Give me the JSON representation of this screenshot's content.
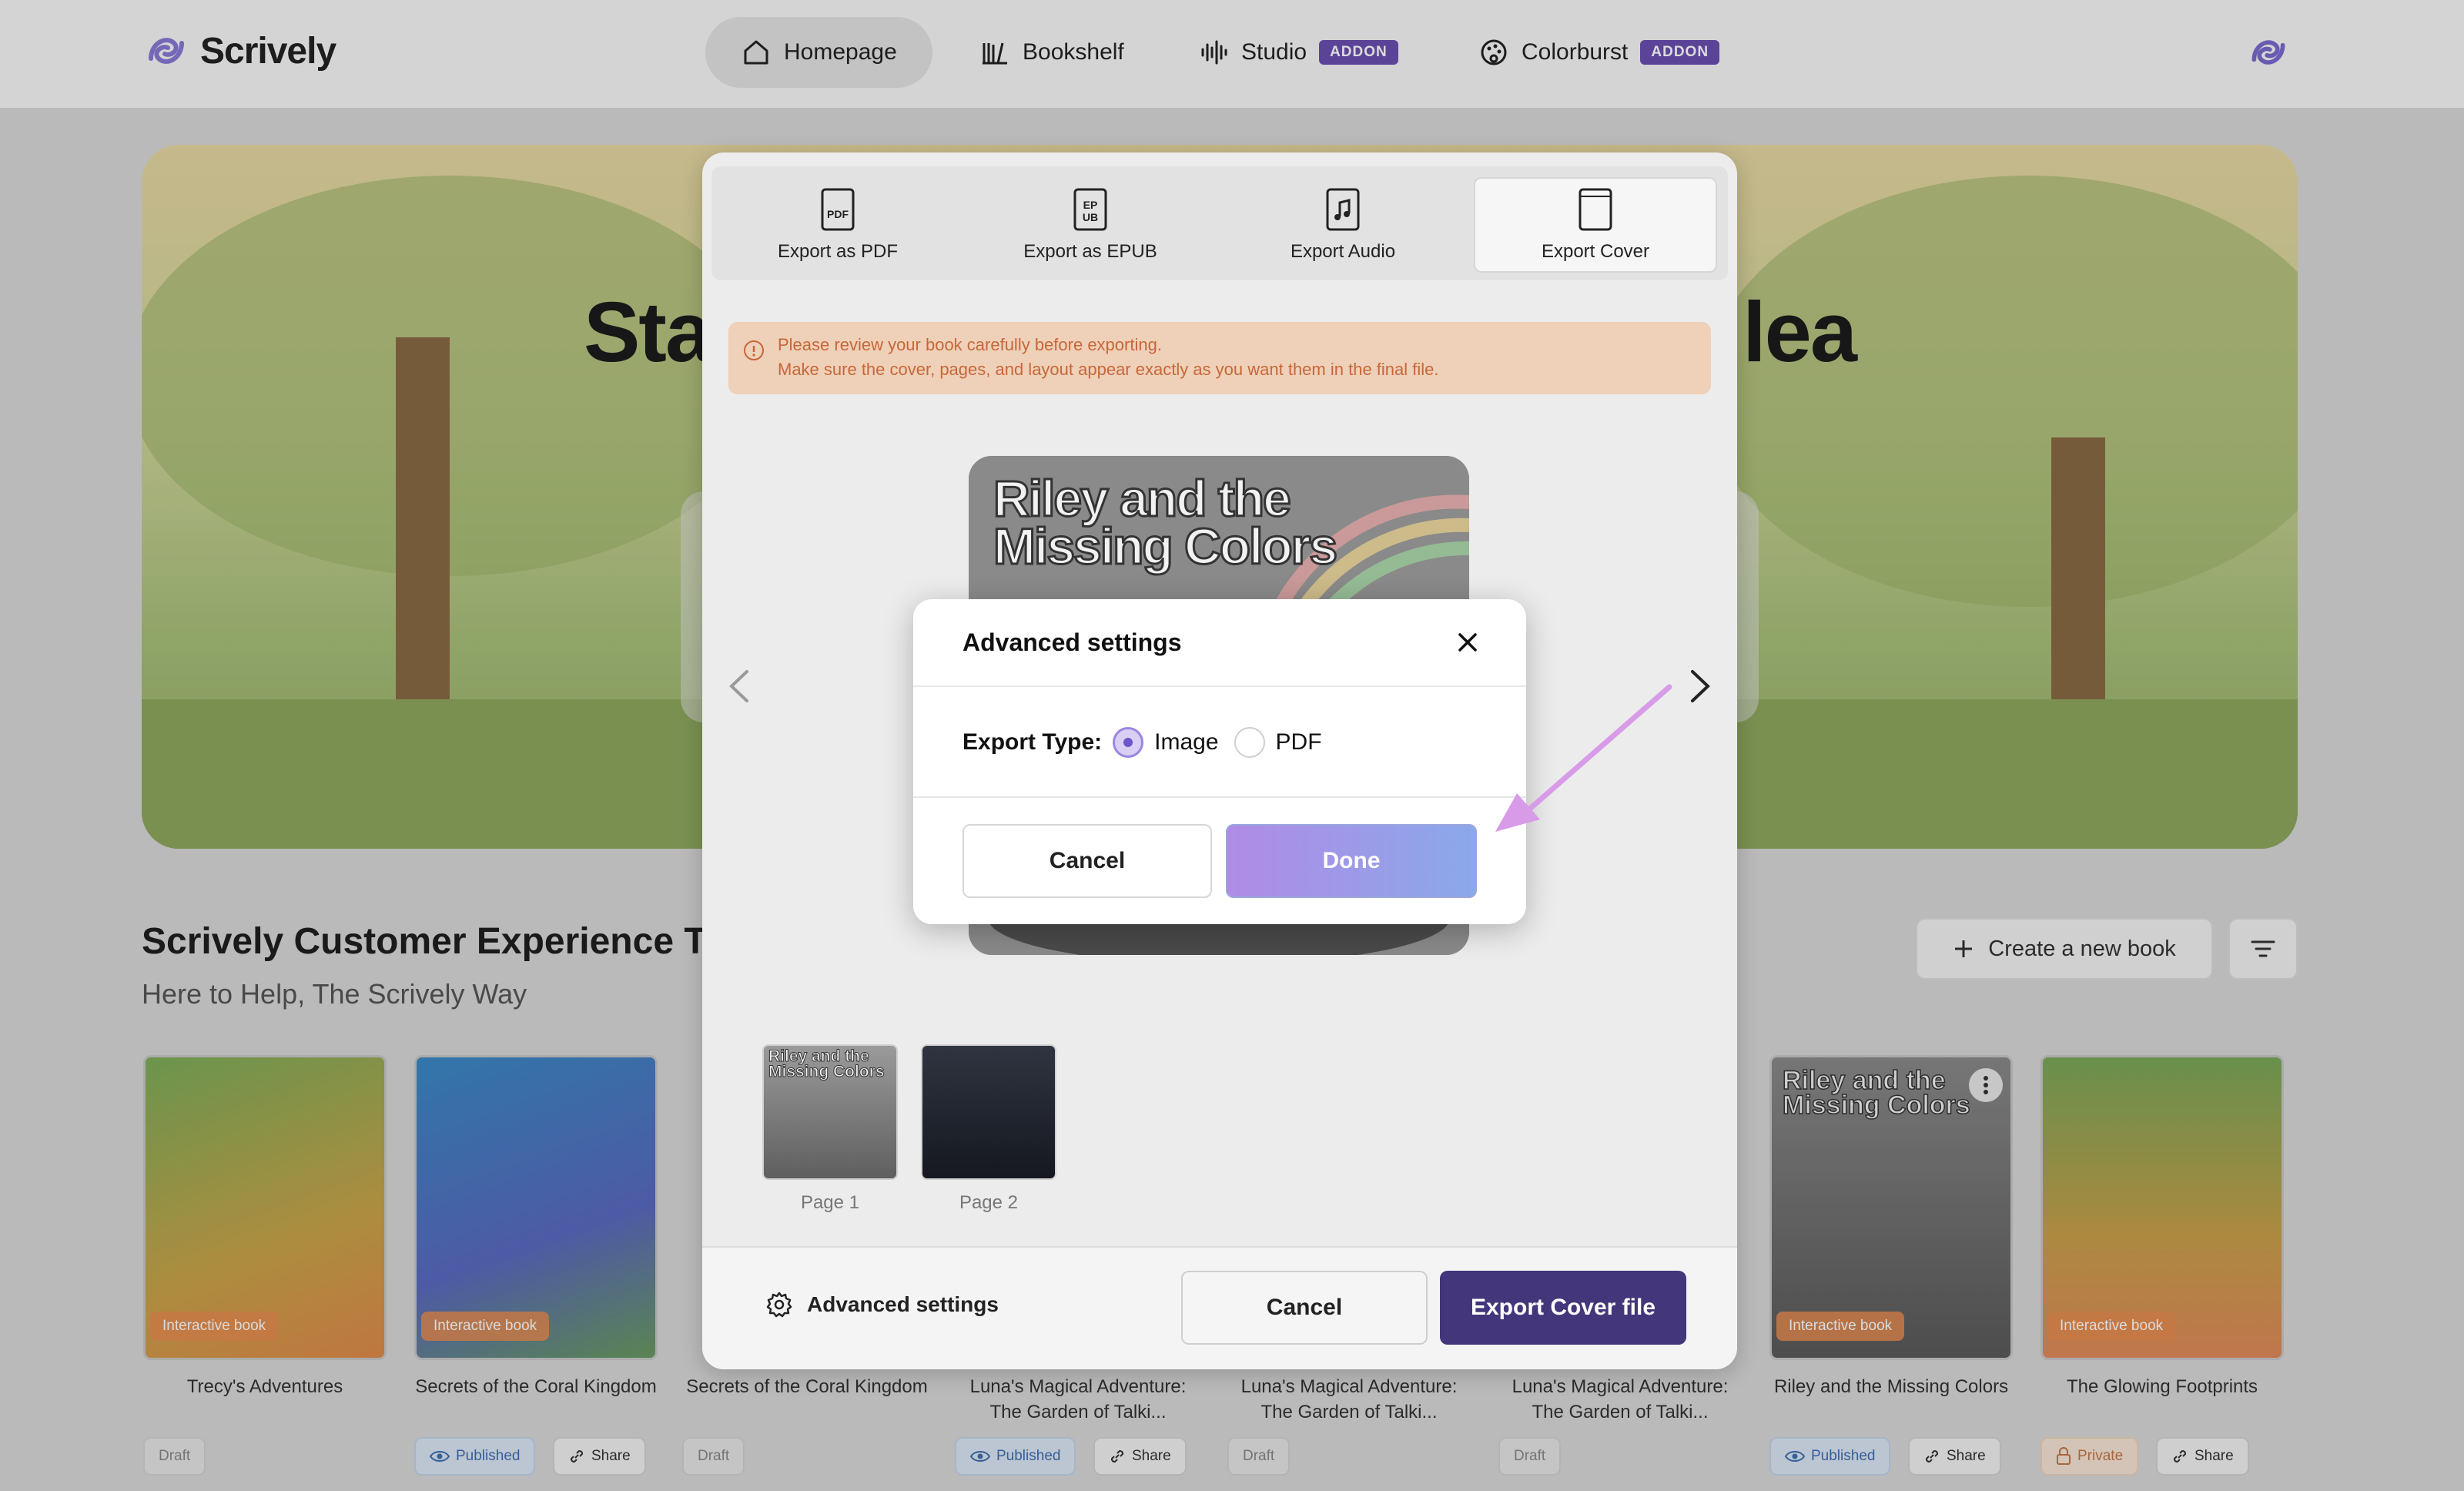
{
  "nav": {
    "brand": "Scrively",
    "items": [
      {
        "label": "Homepage",
        "active": true
      },
      {
        "label": "Bookshelf"
      },
      {
        "label": "Studio",
        "badge": "ADDON"
      },
      {
        "label": "Colorburst",
        "badge": "ADDON"
      }
    ]
  },
  "hero": {
    "title_left": "Sta",
    "title_right": "lea"
  },
  "section": {
    "title": "Scrively Customer Experience Te",
    "subtitle": "Here to Help, The Scrively Way",
    "create_label": "Create a new book"
  },
  "books": [
    {
      "name": "Trecy's Adventures",
      "badge": "Interactive book",
      "status": "Draft"
    },
    {
      "name": "Secrets of the Coral Kingdom",
      "badge": "Interactive book",
      "status": "Published",
      "share": "Share"
    },
    {
      "name": "Secrets of the Coral Kingdom",
      "status": "Draft"
    },
    {
      "name": "Luna's Magical Adventure: The Garden of Talki...",
      "status": "Published",
      "share": "Share"
    },
    {
      "name": "Luna's Magical Adventure: The Garden of Talki...",
      "status": "Draft"
    },
    {
      "name": "Luna's Magical Adventure: The Garden of Talki...",
      "status": "Draft"
    },
    {
      "name": "Riley and the Missing Colors",
      "badge": "Interactive book",
      "status": "Published",
      "share": "Share",
      "cover_title": "Riley and the Missing Colors"
    },
    {
      "name": "The Glowing Footprints",
      "badge": "Interactive book",
      "status": "Private",
      "share": "Share"
    }
  ],
  "export": {
    "tabs": [
      {
        "label": "Export as PDF"
      },
      {
        "label": "Export as EPUB"
      },
      {
        "label": "Export Audio"
      },
      {
        "label": "Export Cover",
        "selected": true
      }
    ],
    "warning_line1": "Please review your book carefully before exporting.",
    "warning_line2": "Make sure the cover, pages, and layout appear exactly as you want them in the final file.",
    "preview_title": "Riley and the Missing Colors",
    "thumbs": [
      {
        "label": "Page 1",
        "title": "Riley and the Missing Colors"
      },
      {
        "label": "Page 2"
      }
    ],
    "advanced_label": "Advanced settings",
    "cancel_label": "Cancel",
    "export_label": "Export Cover file"
  },
  "advanced": {
    "title": "Advanced settings",
    "export_type_label": "Export Type:",
    "options": [
      {
        "label": "Image",
        "selected": true
      },
      {
        "label": "PDF"
      }
    ],
    "cancel_label": "Cancel",
    "done_label": "Done"
  },
  "colors": {
    "accent": "#43367a",
    "addon": "#6a4fb0",
    "warning_bg": "#efd0b8",
    "warning_text": "#c6683a"
  }
}
